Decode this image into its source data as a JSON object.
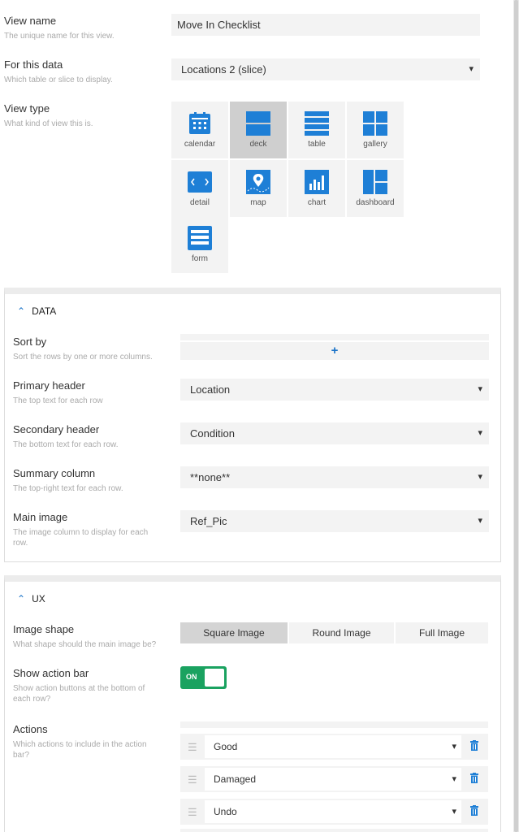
{
  "view_name": {
    "label": "View name",
    "hint": "The unique name for this view.",
    "value": "Move In Checklist"
  },
  "for_data": {
    "label": "For this data",
    "hint": "Which table or slice to display.",
    "value": "Locations 2 (slice)"
  },
  "view_type": {
    "label": "View type",
    "hint": "What kind of view this is.",
    "selected": "deck",
    "options": [
      {
        "label": "calendar",
        "icon": "calendar-icon"
      },
      {
        "label": "deck",
        "icon": "deck-icon"
      },
      {
        "label": "table",
        "icon": "table-icon"
      },
      {
        "label": "gallery",
        "icon": "gallery-icon"
      },
      {
        "label": "detail",
        "icon": "detail-icon"
      },
      {
        "label": "map",
        "icon": "map-icon"
      },
      {
        "label": "chart",
        "icon": "chart-icon"
      },
      {
        "label": "dashboard",
        "icon": "dashboard-icon"
      },
      {
        "label": "form",
        "icon": "form-icon"
      }
    ]
  },
  "data_section": {
    "title": "DATA",
    "sort_by": {
      "label": "Sort by",
      "hint": "Sort the rows by one or more columns.",
      "add": "+"
    },
    "primary_header": {
      "label": "Primary header",
      "hint": "The top text for each row",
      "value": "Location"
    },
    "secondary_header": {
      "label": "Secondary header",
      "hint": "The bottom text for each row.",
      "value": "Condition"
    },
    "summary_column": {
      "label": "Summary column",
      "hint": "The top-right text for each row.",
      "value": "**none**"
    },
    "main_image": {
      "label": "Main image",
      "hint": "The image column to display for each row.",
      "value": "Ref_Pic"
    }
  },
  "ux_section": {
    "title": "UX",
    "image_shape": {
      "label": "Image shape",
      "hint": "What shape should the main image be?",
      "options": [
        "Square Image",
        "Round Image",
        "Full Image"
      ],
      "selected": "Square Image"
    },
    "show_action_bar": {
      "label": "Show action bar",
      "hint": "Show action buttons at the bottom of each row?",
      "state": "ON"
    },
    "actions": {
      "label": "Actions",
      "hint": "Which actions to include in the action bar?",
      "items": [
        "Good",
        "Damaged",
        "Undo"
      ]
    }
  },
  "colors": {
    "accent": "#1a73c8",
    "toggle_on": "#1aa260",
    "icon_blue": "#1e7fd6"
  }
}
